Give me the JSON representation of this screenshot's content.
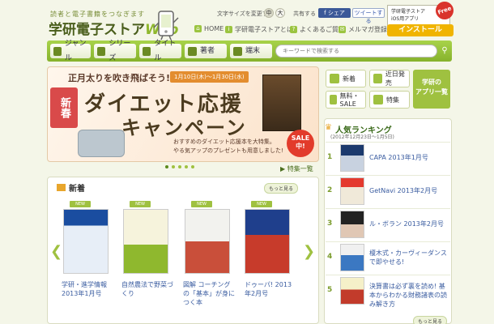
{
  "header": {
    "tagline": "読者と電子書籍をつなぎます",
    "logo_main": "学研電子ストア",
    "logo_web": "Web",
    "font_size_label": "文字サイズを変更する",
    "font_size_mid": "中",
    "font_size_large": "大",
    "share_label": "共有する",
    "fb_share": "シェア",
    "tw_share": "ツイートする",
    "ios_line1": "学研電子ストア",
    "ios_line2": "iOS用アプリ",
    "free_badge": "Free",
    "install_button": "インストール",
    "links": {
      "home": "HOME",
      "about": "学研電子ストアとは?",
      "faq": "よくあるご質問",
      "mail": "メルマガ登録"
    }
  },
  "nav": {
    "genre": "ジャンル",
    "series": "シリーズ",
    "title": "タイトル",
    "author": "著者",
    "device": "端末",
    "search_placeholder": "キーワードで検索する"
  },
  "banner": {
    "top_text": "正月太りを吹き飛ばそう!",
    "date": "1月10日(木)〜1月30日(水)",
    "new_spring": "新春",
    "title1": "ダイエット応援",
    "title2": "キャンペーン",
    "note1": "おすすめのダイエット応援本を大特集。",
    "note2": "やる気アップのプレゼントも用意しました!",
    "sale": "SALE中!",
    "feature_list": "▶ 特集一覧"
  },
  "shortcuts": {
    "new": "新着",
    "soon": "近日発売",
    "free": "無料・SALE",
    "special": "特集",
    "apparel_line1": "学研の",
    "apparel_line2": "アプリ一覧"
  },
  "new_section": {
    "heading": "新着",
    "more": "もっと見る",
    "badge": "NEW",
    "books": [
      {
        "title": "学研・進学情報 2013年1月号"
      },
      {
        "title": "自然農法で野菜づくり"
      },
      {
        "title": "図解 コーチングの「基本」が身につく本"
      },
      {
        "title": "ドゥーパ! 2013年2月号"
      }
    ]
  },
  "ranking": {
    "title": "人気ランキング",
    "range": "(2012年12月23日〜1月5日)",
    "more": "もっと見る",
    "items": [
      {
        "rank": "1",
        "title": "CAPA 2013年1月号"
      },
      {
        "rank": "2",
        "title": "GetNavi 2013年2月号"
      },
      {
        "rank": "3",
        "title": "ル・ボラン 2013年2月号"
      },
      {
        "rank": "4",
        "title": "榎木式・カーヴィーダンスで即やせる!"
      },
      {
        "rank": "5",
        "title": "決算書は必ず裏を読め! 基本からわかる財務諸表の読み解き方"
      }
    ]
  },
  "colors": {
    "accent_green": "#9fc140",
    "install_orange": "#f0b400",
    "link_blue": "#3a5ca0"
  }
}
